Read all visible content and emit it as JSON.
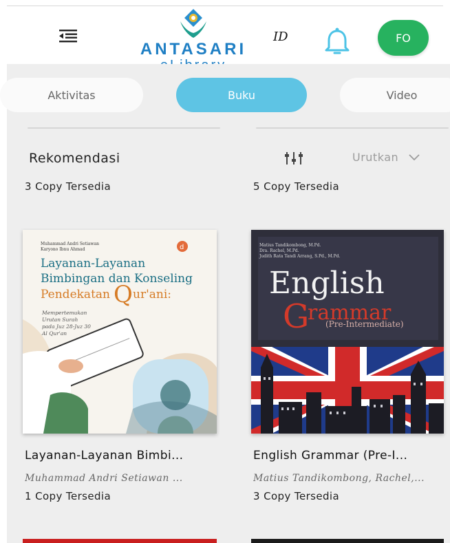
{
  "header": {
    "brand": "ANTASARI",
    "brand_sub": "eLibrary",
    "language": "ID",
    "avatar_initials": "FO",
    "colors": {
      "brand": "#1f7fc4",
      "avatar": "#27b25f",
      "bell": "#4cc3e6"
    },
    "icons": {
      "menu": "menu-icon",
      "bell": "bell-icon"
    }
  },
  "tabs": [
    {
      "label": "Aktivitas",
      "active": false
    },
    {
      "label": "Buku",
      "active": true
    },
    {
      "label": "Video",
      "active": false
    }
  ],
  "section": {
    "title": "Rekomendasi",
    "sort_label": "Urutkan",
    "filter_icon": "sliders-icon"
  },
  "previous_row": [
    {
      "availability": "3 Copy Tersedia"
    },
    {
      "availability": "5 Copy Tersedia"
    }
  ],
  "books": [
    {
      "title": "Layanan-Layanan Bimbi...",
      "author": "Muhammad Andri Setiawan ...",
      "availability": "1 Copy Tersedia",
      "cover": {
        "authors_line1": "Muhammad Andri Setiawan",
        "authors_line2": "Karyono Ibnu Ahmad",
        "line1": "Layanan-Layanan",
        "line2": "Bimbingan dan Konseling",
        "line3a": "Pendekatan",
        "line3b": "ur'ani:",
        "big_q": "Q",
        "sub1": "Mempertemukan",
        "sub2": "Urutan Surah",
        "sub3": "pada Juz 28-Juz 30",
        "sub4": "Al Qur'an",
        "publisher_mark": "d"
      }
    },
    {
      "title": "English Grammar (Pre-I...",
      "author": "Matius Tandikombong, Rachel,...",
      "availability": "3 Copy Tersedia",
      "cover": {
        "authors_line1": "Matius Tandikombong, M.Pd.",
        "authors_line2": "Dra. Rachel, M.Pd.",
        "authors_line3": "Judith Rata Tandi Arrang, S.Pd., M.Pd.",
        "word1": "English",
        "word2_first": "G",
        "word2_rest": "rammar",
        "subtitle": "(Pre-Intermediate)"
      }
    }
  ]
}
